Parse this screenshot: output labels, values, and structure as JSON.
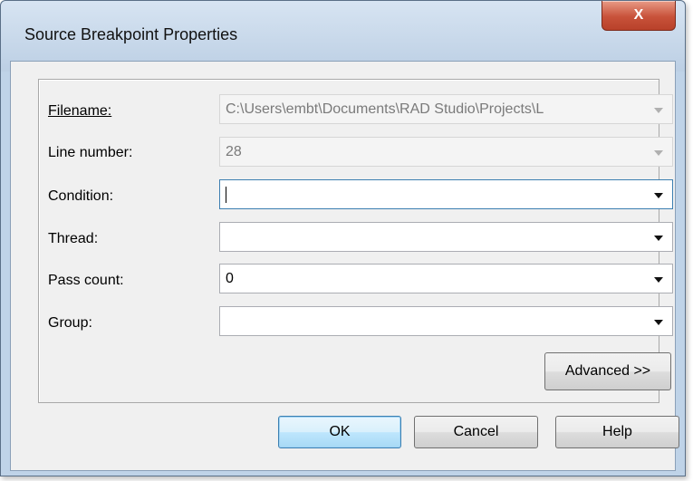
{
  "window": {
    "title": "Source Breakpoint Properties",
    "close_glyph": "X"
  },
  "form": {
    "filename": {
      "label": "Filename:",
      "value": "C:\\Users\\embt\\Documents\\RAD Studio\\Projects\\L"
    },
    "line_number": {
      "label": "Line number:",
      "value": "28"
    },
    "condition": {
      "label": "Condition:",
      "value": ""
    },
    "thread": {
      "label": "Thread:",
      "value": ""
    },
    "pass_count": {
      "label": "Pass count:",
      "value": "0"
    },
    "group": {
      "label": "Group:",
      "value": ""
    },
    "advanced_label": "Advanced >>"
  },
  "buttons": {
    "ok": "OK",
    "cancel": "Cancel",
    "help": "Help"
  }
}
